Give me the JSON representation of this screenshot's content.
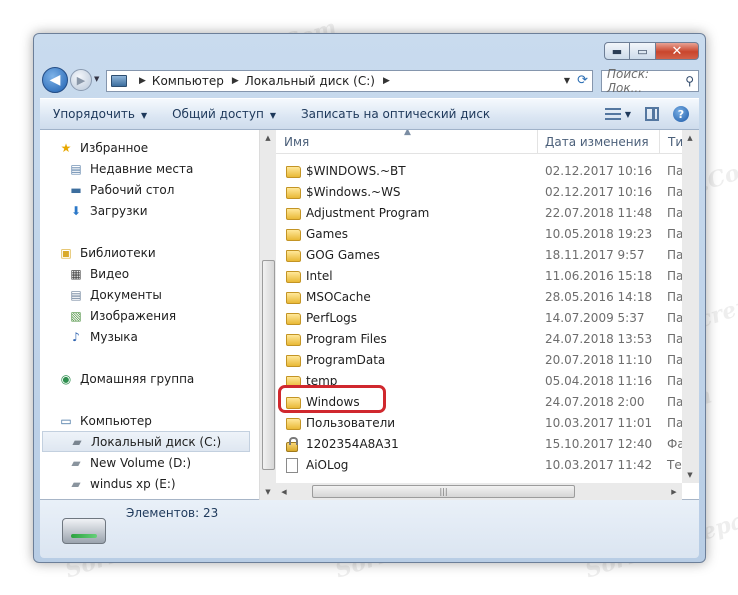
{
  "watermark": "Soringpcrepair.Com",
  "window_controls": {
    "minimize": "▬",
    "maximize": "▭",
    "close": "✕"
  },
  "navbar": {
    "back_glyph": "◀",
    "forward_glyph": "▶",
    "breadcrumbs": [
      "Компьютер",
      "Локальный диск (C:)"
    ],
    "search_placeholder": "Поиск: Лок..."
  },
  "toolbar": {
    "organize": "Упорядочить",
    "share": "Общий доступ",
    "burn": "Записать на оптический диск"
  },
  "nav_pane": {
    "items": [
      {
        "label": "Избранное",
        "icon": "star-icon",
        "level": 0
      },
      {
        "label": "Недавние места",
        "icon": "recent-places-icon",
        "level": 1
      },
      {
        "label": "Рабочий стол",
        "icon": "desktop-icon",
        "level": 1
      },
      {
        "label": "Загрузки",
        "icon": "downloads-icon",
        "level": 1
      },
      {
        "label": "Библиотеки",
        "icon": "libraries-icon",
        "level": 0
      },
      {
        "label": "Видео",
        "icon": "video-icon",
        "level": 1
      },
      {
        "label": "Документы",
        "icon": "documents-icon",
        "level": 1
      },
      {
        "label": "Изображения",
        "icon": "pictures-icon",
        "level": 1
      },
      {
        "label": "Музыка",
        "icon": "music-icon",
        "level": 1
      },
      {
        "label": "Домашняя группа",
        "icon": "homegroup-icon",
        "level": 0
      },
      {
        "label": "Компьютер",
        "icon": "computer-icon",
        "level": 0
      },
      {
        "label": "Локальный диск (C:)",
        "icon": "system-drive-icon",
        "level": 1,
        "selected": true
      },
      {
        "label": "New Volume (D:)",
        "icon": "drive-icon",
        "level": 1
      },
      {
        "label": "windus xp (E:)",
        "icon": "drive-icon",
        "level": 1
      }
    ]
  },
  "columns": {
    "name": "Имя",
    "date": "Дата изменения",
    "type": "Ти"
  },
  "files": [
    {
      "name": "$WINDOWS.~BT",
      "date": "02.12.2017 10:16",
      "type": "Па",
      "icon": "folder-icon"
    },
    {
      "name": "$Windows.~WS",
      "date": "02.12.2017 10:16",
      "type": "Па",
      "icon": "folder-icon"
    },
    {
      "name": "Adjustment Program",
      "date": "22.07.2018 11:48",
      "type": "Па",
      "icon": "folder-icon"
    },
    {
      "name": "Games",
      "date": "10.05.2018 19:23",
      "type": "Па",
      "icon": "folder-icon"
    },
    {
      "name": "GOG Games",
      "date": "18.11.2017 9:57",
      "type": "Па",
      "icon": "folder-icon"
    },
    {
      "name": "Intel",
      "date": "11.06.2016 15:18",
      "type": "Па",
      "icon": "folder-icon"
    },
    {
      "name": "MSOCache",
      "date": "28.05.2016 14:18",
      "type": "Па",
      "icon": "folder-icon"
    },
    {
      "name": "PerfLogs",
      "date": "14.07.2009 5:37",
      "type": "Па",
      "icon": "folder-icon"
    },
    {
      "name": "Program Files",
      "date": "24.07.2018 13:53",
      "type": "Па",
      "icon": "folder-icon"
    },
    {
      "name": "ProgramData",
      "date": "20.07.2018 11:10",
      "type": "Па",
      "icon": "folder-icon"
    },
    {
      "name": "temp",
      "date": "05.04.2018 11:16",
      "type": "Па",
      "icon": "folder-icon"
    },
    {
      "name": "Windows",
      "date": "24.07.2018 2:00",
      "type": "Па",
      "icon": "folder-icon",
      "highlighted": true
    },
    {
      "name": "Пользователи",
      "date": "10.03.2017 11:01",
      "type": "Па",
      "icon": "folder-icon"
    },
    {
      "name": "1202354A8A31",
      "date": "15.10.2017 12:40",
      "type": "Фа",
      "icon": "lock-icon"
    },
    {
      "name": "AiOLog",
      "date": "10.03.2017 11:42",
      "type": "Те",
      "icon": "file-icon"
    }
  ],
  "status": {
    "items_count": "Элементов: 23"
  },
  "colors": {
    "accent": "#d0282e",
    "frame": "#c9dbee"
  }
}
